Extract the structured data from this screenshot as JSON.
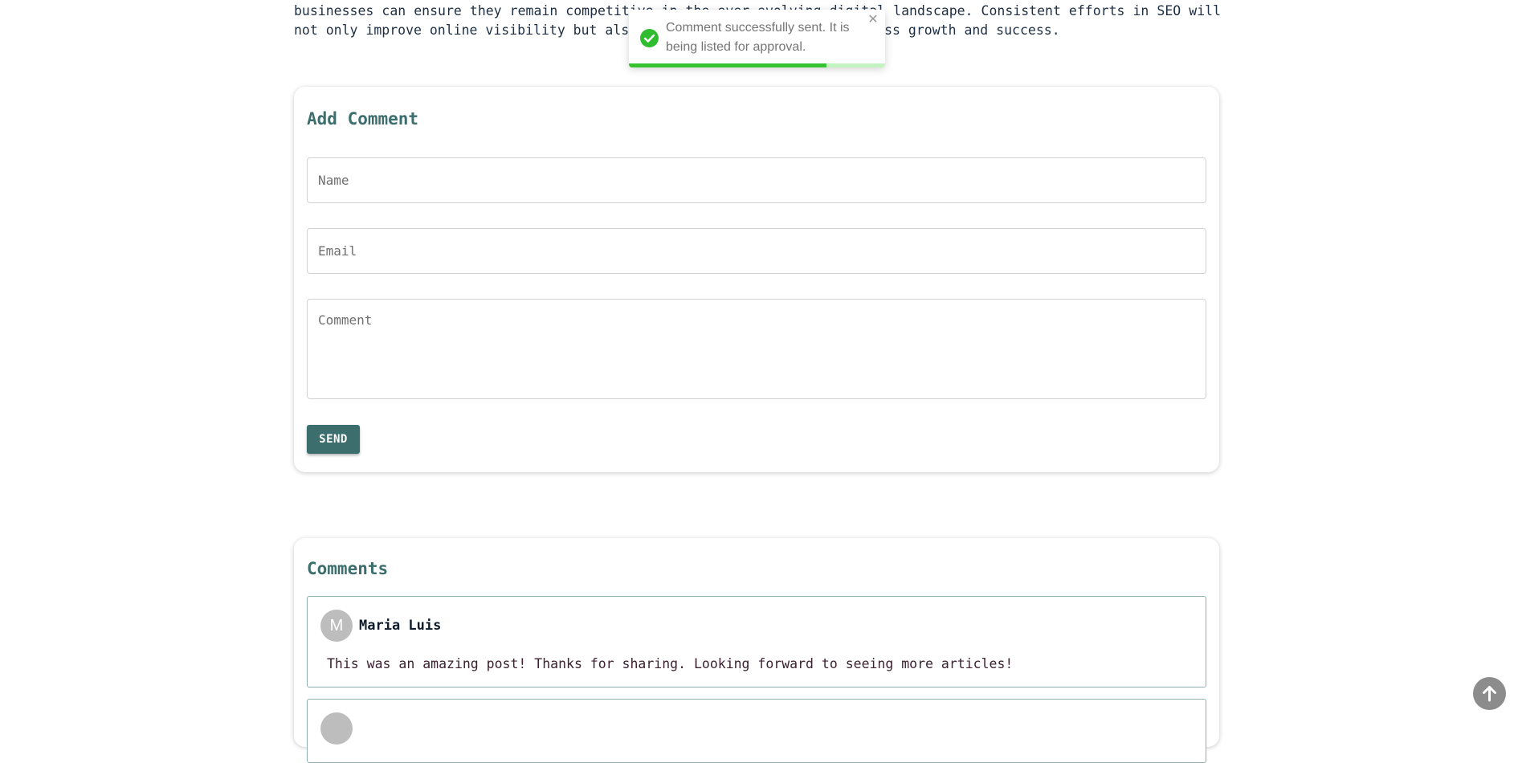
{
  "article": {
    "text": "businesses can ensure they remain competitive in the ever-evolving digital landscape. Consistent efforts in SEO will not only improve online visibility but also contribute to long-term business growth and success."
  },
  "add_comment": {
    "title": "Add Comment",
    "name_placeholder": "Name",
    "email_placeholder": "Email",
    "comment_placeholder": "Comment",
    "send_label": "SEND"
  },
  "comments": {
    "title": "Comments",
    "items": [
      {
        "initial": "M",
        "author": "Maria Luis",
        "text": "This was an amazing post! Thanks for sharing. Looking forward to seeing more articles!"
      }
    ]
  },
  "toast": {
    "message": "Comment successfully sent. It is being listed for approval.",
    "icon": "check-circle-icon",
    "close_icon": "close-icon",
    "progress": 0.77,
    "colors": {
      "progress": "#35c42f",
      "track": "#c4f3c2",
      "icon": "#2fbd2f"
    }
  },
  "scroll_top": {
    "icon": "arrow-up-icon"
  },
  "colors": {
    "accent": "#3b6e6c",
    "comment_border": "#8fb0ae"
  }
}
